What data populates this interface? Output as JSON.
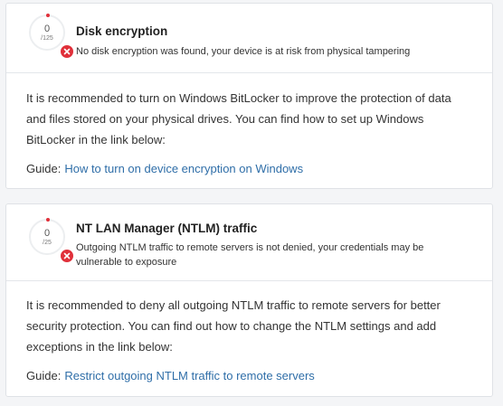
{
  "colors": {
    "danger": "#e0303a",
    "link": "#2f6ea8",
    "score_ring": "#eceef0"
  },
  "cards": [
    {
      "title": "Disk encryption",
      "description": "No disk encryption was found, your device is at risk from physical tampering",
      "score": {
        "value": "0",
        "max": "125"
      },
      "status_icon": "x-icon",
      "body": "It is recommended to turn on Windows BitLocker to improve the protection of data and files stored on your physical drives. You can find how to set up Windows BitLocker in the link below:",
      "guide_label": "Guide",
      "guide_link": "How to turn on device encryption on Windows"
    },
    {
      "title": "NT LAN Manager (NTLM) traffic",
      "description": "Outgoing NTLM traffic to remote servers is not denied, your credentials may be vulnerable to exposure",
      "score": {
        "value": "0",
        "max": "25"
      },
      "status_icon": "x-icon",
      "body": "It is recommended to deny all outgoing NTLM traffic to remote servers for better security protection. You can find out how to change the NTLM settings and add exceptions in the link below:",
      "guide_label": "Guide",
      "guide_link": "Restrict outgoing NTLM traffic to remote servers"
    }
  ]
}
